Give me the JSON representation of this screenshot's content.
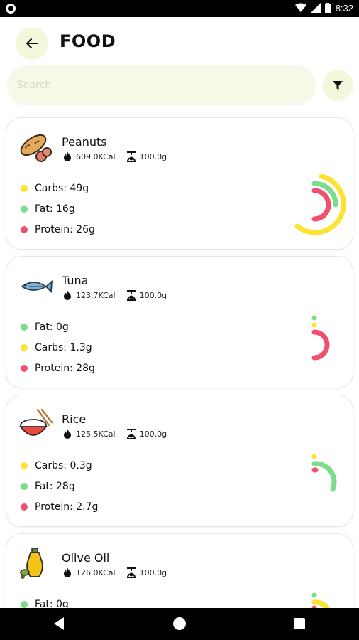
{
  "status_bar": {
    "time": "8:32"
  },
  "header": {
    "title": "FOOD"
  },
  "search": {
    "placeholder": "Search"
  },
  "foods": [
    {
      "name": "Peanuts",
      "icon": "peanut-icon",
      "kcal": "609.0KCal",
      "weight": "100.0g",
      "nutrients": [
        {
          "label": "Carbs: 49g",
          "color": "#fde232"
        },
        {
          "label": "Fat: 16g",
          "color": "#7bdc8a"
        },
        {
          "label": "Protein: 26g",
          "color": "#f0506e"
        }
      ],
      "ring": {
        "carbs": 49,
        "fat": 16,
        "protein": 26
      }
    },
    {
      "name": "Tuna",
      "icon": "fish-icon",
      "kcal": "123.7KCal",
      "weight": "100.0g",
      "nutrients": [
        {
          "label": "Fat: 0g",
          "color": "#7bdc8a"
        },
        {
          "label": "Carbs: 1.3g",
          "color": "#fde232"
        },
        {
          "label": "Protein: 28g",
          "color": "#f0506e"
        }
      ],
      "ring": {
        "fat": 0,
        "carbs": 1.3,
        "protein": 28
      }
    },
    {
      "name": "Rice",
      "icon": "rice-bowl-icon",
      "kcal": "125.5KCal",
      "weight": "100.0g",
      "nutrients": [
        {
          "label": "Carbs: 0.3g",
          "color": "#fde232"
        },
        {
          "label": "Fat: 28g",
          "color": "#7bdc8a"
        },
        {
          "label": "Protein: 2.7g",
          "color": "#f0506e"
        }
      ],
      "ring": {
        "carbs": 0.3,
        "fat": 28,
        "protein": 2.7
      }
    },
    {
      "name": "Olive Oil",
      "icon": "olive-oil-icon",
      "kcal": "126.0KCal",
      "weight": "100.0g",
      "nutrients": [
        {
          "label": "Fat: 0g",
          "color": "#7bdc8a"
        }
      ],
      "ring": {
        "fat": 0,
        "carbs": 0,
        "protein": 0
      }
    }
  ],
  "colors": {
    "carbs": "#fde232",
    "fat": "#7bdc8a",
    "protein": "#f0506e",
    "accent_bg": "#f4f7dc"
  }
}
